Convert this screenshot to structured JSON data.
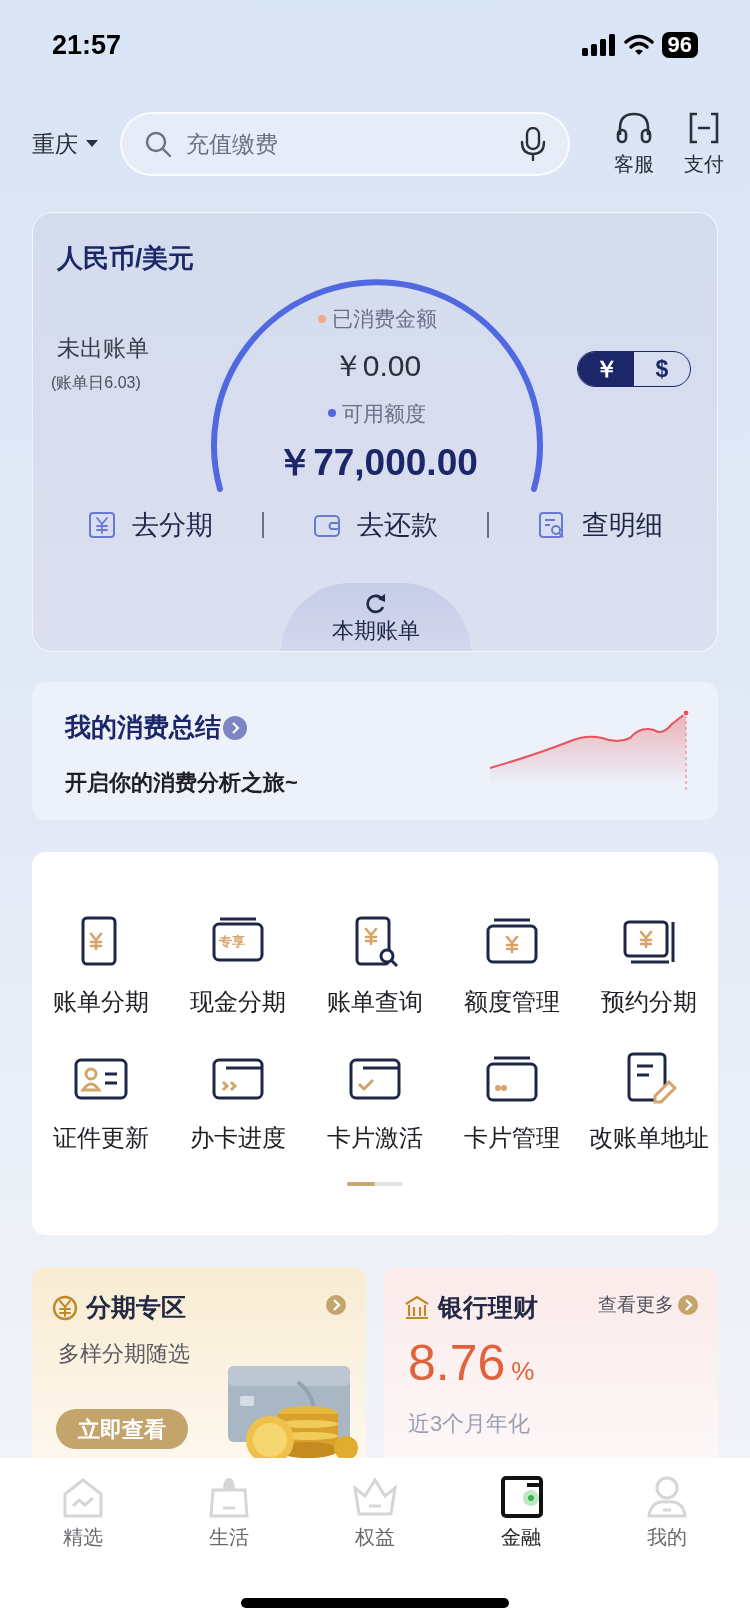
{
  "status_bar": {
    "time": "21:57",
    "battery": "96"
  },
  "header": {
    "city": "重庆",
    "search": {
      "placeholder": "充值缴费"
    },
    "actions": [
      {
        "label": "客服",
        "kind": "headset"
      },
      {
        "label": "支付",
        "kind": "scan"
      }
    ]
  },
  "credit_card": {
    "title": "人民币/美元",
    "bill_status": "未出账单",
    "bill_date": "(账单日6.03)",
    "spent_label": "已消费金额",
    "spent": "￥0.00",
    "available_label": "可用额度",
    "available": "￥77,000.00",
    "currencies": [
      {
        "label": "￥",
        "selected": true
      },
      {
        "label": "$",
        "selected": false
      }
    ],
    "actions": [
      {
        "label": "去分期",
        "kind": "yuan"
      },
      {
        "label": "去还款",
        "kind": "wallet"
      },
      {
        "label": "查明细",
        "kind": "detail"
      }
    ],
    "bill_tab": "本期账单"
  },
  "summary": {
    "title": "我的消费总结",
    "subtitle": "开启你的消费分析之旅~"
  },
  "services": [
    {
      "label": "账单分期",
      "kind": "bill_installment"
    },
    {
      "label": "现金分期",
      "kind": "cash_installment",
      "badge": "专享"
    },
    {
      "label": "账单查询",
      "kind": "bill_query"
    },
    {
      "label": "额度管理",
      "kind": "limit"
    },
    {
      "label": "预约分期",
      "kind": "scheduled"
    },
    {
      "label": "证件更新",
      "kind": "id_update"
    },
    {
      "label": "办卡进度",
      "kind": "progress"
    },
    {
      "label": "卡片激活",
      "kind": "activate"
    },
    {
      "label": "卡片管理",
      "kind": "card_manage"
    },
    {
      "label": "改账单地址",
      "kind": "address"
    }
  ],
  "promos": [
    {
      "kind": "installment",
      "title": "分期专区",
      "subtitle": "多样分期随选",
      "button": "立即查看"
    },
    {
      "kind": "wealth",
      "title": "银行理财",
      "more": "查看更多",
      "rate": "8.76",
      "unit": "%",
      "rate_label": "近3个月年化"
    }
  ],
  "tab_bar": [
    {
      "label": "精选",
      "kind": "home",
      "selected": false
    },
    {
      "label": "生活",
      "kind": "bag",
      "selected": false
    },
    {
      "label": "权益",
      "kind": "crown",
      "selected": false
    },
    {
      "label": "金融",
      "kind": "wallet",
      "selected": true
    },
    {
      "label": "我的",
      "kind": "person",
      "selected": false
    }
  ]
}
